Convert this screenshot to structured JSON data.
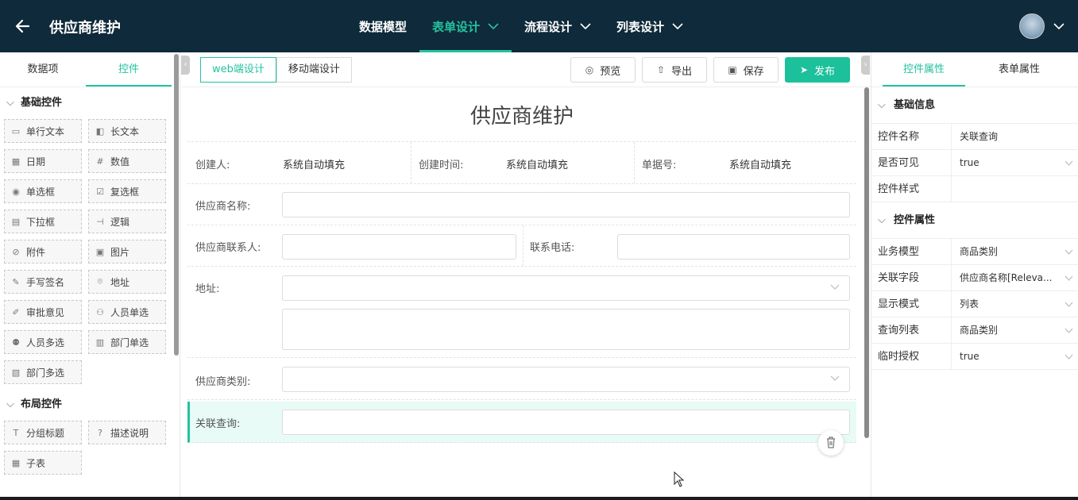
{
  "header": {
    "back_icon": "arrow-left-icon",
    "title": "供应商维护",
    "nav": [
      {
        "label": "数据模型",
        "active": false,
        "has_chevron": false
      },
      {
        "label": "表单设计",
        "active": true,
        "has_chevron": true
      },
      {
        "label": "流程设计",
        "active": false,
        "has_chevron": true
      },
      {
        "label": "列表设计",
        "active": false,
        "has_chevron": true
      }
    ],
    "accent_color": "#25c2a0",
    "bg_color": "#0f2a3a"
  },
  "left_panel": {
    "tabs": [
      "数据项",
      "控件"
    ],
    "active_tab": "控件",
    "sections": [
      {
        "title": "基础控件",
        "items": [
          {
            "label": "单行文本",
            "icon": "text-input-icon"
          },
          {
            "label": "长文本",
            "icon": "textarea-icon"
          },
          {
            "label": "日期",
            "icon": "calendar-icon"
          },
          {
            "label": "数值",
            "icon": "number-icon"
          },
          {
            "label": "单选框",
            "icon": "radio-icon"
          },
          {
            "label": "复选框",
            "icon": "checkbox-icon"
          },
          {
            "label": "下拉框",
            "icon": "dropdown-icon"
          },
          {
            "label": "逻辑",
            "icon": "logic-icon"
          },
          {
            "label": "附件",
            "icon": "attachment-icon"
          },
          {
            "label": "图片",
            "icon": "image-icon"
          },
          {
            "label": "手写签名",
            "icon": "pen-icon"
          },
          {
            "label": "地址",
            "icon": "location-icon"
          },
          {
            "label": "审批意见",
            "icon": "edit-icon"
          },
          {
            "label": "人员单选",
            "icon": "user-icon"
          },
          {
            "label": "人员多选",
            "icon": "users-icon"
          },
          {
            "label": "部门单选",
            "icon": "department-icon"
          },
          {
            "label": "部门多选",
            "icon": "departments-icon"
          }
        ]
      },
      {
        "title": "布局控件",
        "items": [
          {
            "label": "分组标题",
            "icon": "title-icon"
          },
          {
            "label": "描述说明",
            "icon": "help-icon"
          },
          {
            "label": "子表",
            "icon": "table-icon"
          }
        ]
      }
    ]
  },
  "toolbar": {
    "modes": [
      "web端设计",
      "移动端设计"
    ],
    "active_mode": "web端设计",
    "preview": "预览",
    "export": "导出",
    "save": "保存",
    "publish": "发布"
  },
  "form": {
    "title": "供应商维护",
    "meta": [
      {
        "label": "创建人:",
        "value": "系统自动填充"
      },
      {
        "label": "创建时间:",
        "value": "系统自动填充"
      },
      {
        "label": "单据号:",
        "value": "系统自动填充"
      }
    ],
    "supplier_name_label": "供应商名称:",
    "contact_label": "供应商联系人:",
    "phone_label": "联系电话:",
    "address_label": "地址:",
    "category_label": "供应商类别:",
    "relation_query_label": "关联查询:"
  },
  "right_panel": {
    "tabs": [
      "控件属性",
      "表单属性"
    ],
    "active_tab": "控件属性",
    "basic_section": "基础信息",
    "basic_rows": [
      {
        "key": "控件名称",
        "value": "关联查询",
        "dropdown": false
      },
      {
        "key": "是否可见",
        "value": "true",
        "dropdown": true
      },
      {
        "key": "控件样式",
        "value": "",
        "dropdown": false
      }
    ],
    "prop_section": "控件属性",
    "prop_rows": [
      {
        "key": "业务模型",
        "value": "商品类别",
        "dropdown": true
      },
      {
        "key": "关联字段",
        "value": "供应商名称[Releva...",
        "dropdown": true
      },
      {
        "key": "显示模式",
        "value": "列表",
        "dropdown": true
      },
      {
        "key": "查询列表",
        "value": "商品类别",
        "dropdown": true
      },
      {
        "key": "临时授权",
        "value": "true",
        "dropdown": true
      }
    ]
  }
}
